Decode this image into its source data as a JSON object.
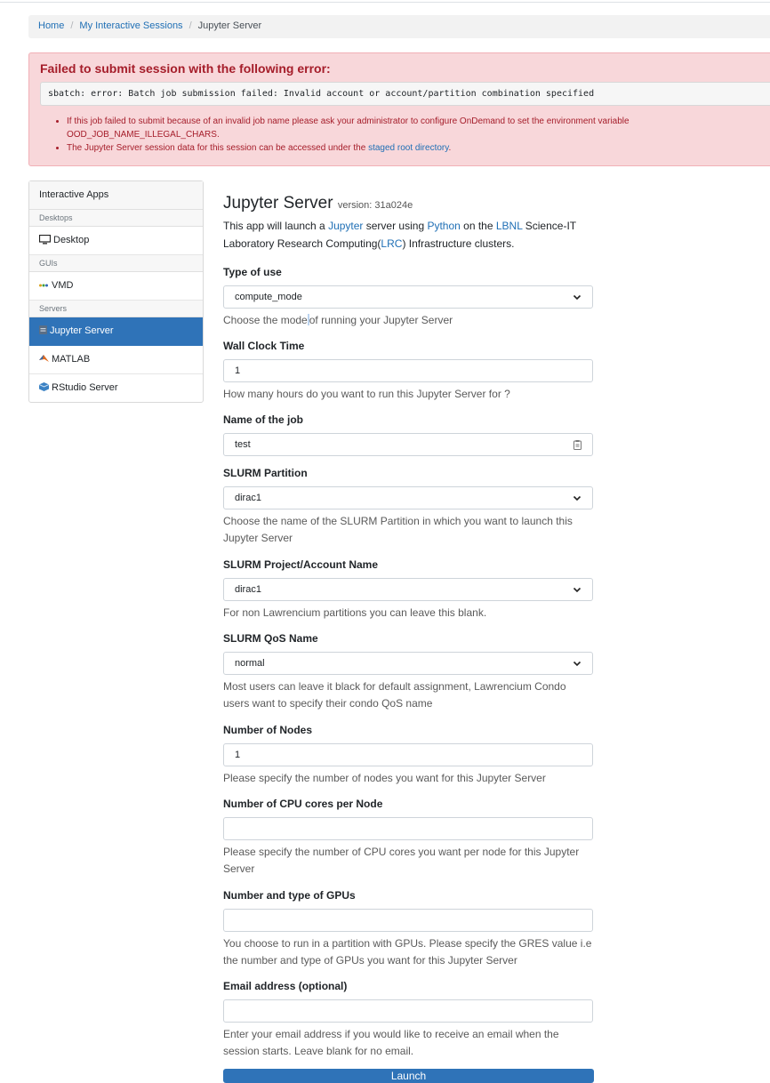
{
  "breadcrumb": {
    "home": "Home",
    "sessions": "My Interactive Sessions",
    "current": "Jupyter Server"
  },
  "alert": {
    "title": "Failed to submit session with the following error:",
    "error": "sbatch: error: Batch job submission failed: Invalid account or account/partition combination specified",
    "item1_line1": "If this job failed to submit because of an invalid job name please ask your administrator to configure OnDemand to set the environment variable",
    "item1_line2": "OOD_JOB_NAME_ILLEGAL_CHARS.",
    "item2_pre": "The Jupyter Server session data for this session can be accessed under the ",
    "item2_link": "staged root directory",
    "item2_post": "."
  },
  "sidebar": {
    "header": "Interactive Apps",
    "cat_desktops": "Desktops",
    "desktop": "Desktop",
    "cat_guis": "GUIs",
    "vmd": "VMD",
    "cat_servers": "Servers",
    "jupyter": "Jupyter Server",
    "matlab": "MATLAB",
    "rstudio": "RStudio Server"
  },
  "app": {
    "title": "Jupyter Server",
    "version": "version: 31a024e",
    "desc_1": "This app will launch a ",
    "link_jupyter": "Jupyter",
    "desc_2": " server using ",
    "link_python": "Python",
    "desc_3": " on the ",
    "link_lbnl": "LBNL",
    "desc_4": " Science-IT",
    "desc_5": "Laboratory Research Computing(",
    "link_lrc": "LRC",
    "desc_6": ") Infrastructure clusters."
  },
  "form": {
    "type_of_use": {
      "label": "Type of use",
      "value": "compute_mode",
      "help_a": "Choose the mode",
      "help_b": "of running your Jupyter Server"
    },
    "wall_clock": {
      "label": "Wall Clock Time",
      "value": "1",
      "help": "How many hours do you want to run this Jupyter Server for ?"
    },
    "job_name": {
      "label": "Name of the job",
      "value": "test"
    },
    "partition": {
      "label": "SLURM Partition",
      "value": "dirac1",
      "help_1": "Choose the name of the SLURM Partition in which you want to launch this",
      "help_2": "Jupyter Server"
    },
    "account": {
      "label": "SLURM Project/Account Name",
      "value": "dirac1",
      "help": "For non Lawrencium partitions you can leave this blank."
    },
    "qos": {
      "label": "SLURM QoS Name",
      "value": "normal",
      "help_1": "Most users can leave it black for default assignment, Lawrencium Condo",
      "help_2": "users want to specify their condo QoS name"
    },
    "nodes": {
      "label": "Number of Nodes",
      "value": "1",
      "help": "Please specify the number of nodes you want for this Jupyter Server"
    },
    "cores": {
      "label": "Number of CPU cores per Node",
      "value": "",
      "help_1": "Please specify the number of CPU cores you want per node for this Jupyter",
      "help_2": "Server"
    },
    "gpus": {
      "label": "Number and type of GPUs",
      "value": "",
      "help_1": "You choose to run in a partition with GPUs. Please specify the GRES value i.e",
      "help_2": "the number and type of GPUs you want for this Jupyter Server"
    },
    "email": {
      "label": "Email address (optional)",
      "value": "",
      "help_1": "Enter your email address if you would like to receive an email when the",
      "help_2": "session starts. Leave blank for no email."
    }
  },
  "launch_label": "Launch"
}
